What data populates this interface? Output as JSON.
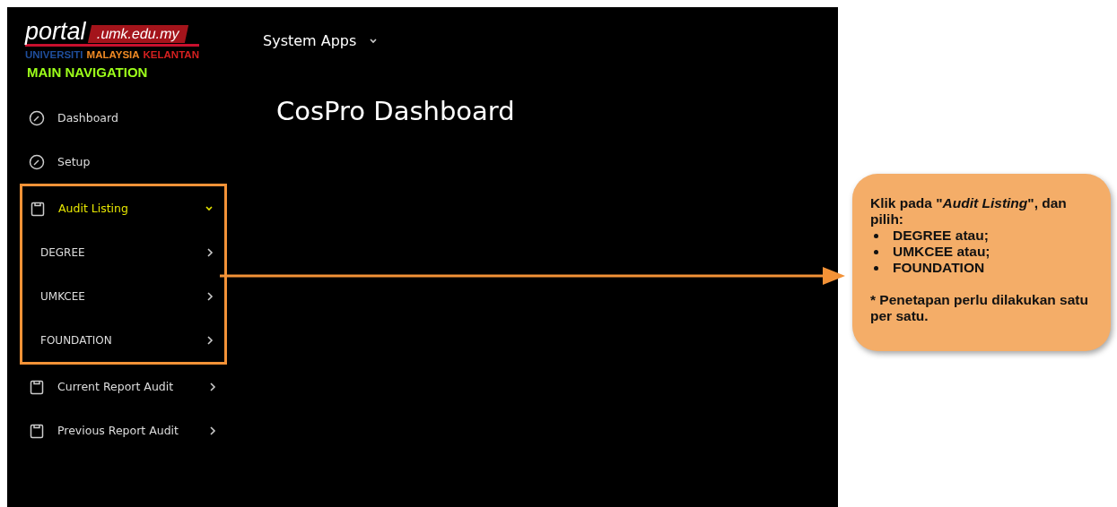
{
  "logo": {
    "word": "portal",
    "domain": ".umk.edu.my",
    "tagline": [
      {
        "text": "UNIVERSITI",
        "color": "#1f4e9c"
      },
      {
        "text": "MALAYSIA",
        "color": "#f08a24"
      },
      {
        "text": "KELANTAN",
        "color": "#d62020"
      }
    ]
  },
  "header": {
    "menu": "System Apps"
  },
  "sidebar": {
    "heading": "MAIN NAVIGATION",
    "items": [
      {
        "label": "Dashboard",
        "kind": "gauge",
        "selected": false
      },
      {
        "label": "Setup",
        "kind": "gauge",
        "selected": false
      },
      {
        "label": "Audit Listing",
        "kind": "clipboard",
        "selected": true,
        "expanded": true,
        "highlighted": true,
        "children": [
          {
            "label": "DEGREE"
          },
          {
            "label": "UMKCEE"
          },
          {
            "label": "FOUNDATION"
          }
        ]
      },
      {
        "label": "Current Report Audit",
        "kind": "clipboard",
        "selected": false,
        "expanded": false
      },
      {
        "label": "Previous Report Audit",
        "kind": "clipboard",
        "selected": false,
        "expanded": false
      }
    ]
  },
  "main": {
    "title": "CosPro Dashboard"
  },
  "callout": {
    "intro": "Klik pada \"*Audit Listing*\", dan pilih:",
    "bullets": [
      "DEGREE atau;",
      "UMKCEE atau;",
      "FOUNDATION"
    ],
    "note": "* Penetapan perlu dilakukan satu per satu."
  }
}
